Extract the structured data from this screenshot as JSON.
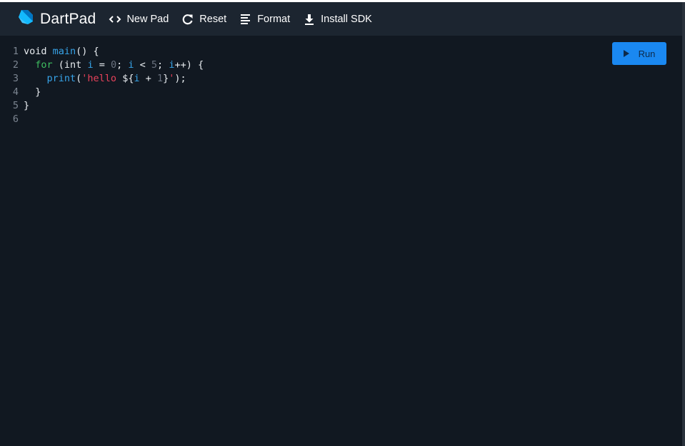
{
  "app": {
    "title": "DartPad",
    "logo_icon": "dart-logo-icon"
  },
  "toolbar": {
    "items": [
      {
        "label": "New Pad",
        "icon": "code-brackets-icon"
      },
      {
        "label": "Reset",
        "icon": "refresh-icon"
      },
      {
        "label": "Format",
        "icon": "format-align-icon"
      },
      {
        "label": "Install SDK",
        "icon": "download-icon"
      }
    ]
  },
  "run_button": {
    "label": "Run",
    "icon": "play-icon"
  },
  "editor": {
    "line_numbers": [
      "1",
      "2",
      "3",
      "4",
      "5",
      "6"
    ],
    "lines": [
      "void main() {",
      "  for (int i = 0; i < 5; i++) {",
      "    print('hello ${i + 1}');",
      "  }",
      "}",
      ""
    ]
  },
  "colors": {
    "header_bg": "#1c2530",
    "editor_bg": "#111821",
    "accent": "#1a88f1",
    "keyword_control": "#3fbf61",
    "identifier": "#37a3e8",
    "string": "#e8425b",
    "number": "#6b7380"
  }
}
